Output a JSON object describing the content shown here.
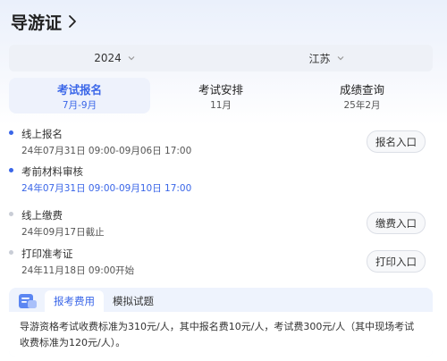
{
  "header": {
    "title": "导游证"
  },
  "filters": {
    "year": "2024",
    "province": "江苏"
  },
  "tabs": [
    {
      "label": "考试报名",
      "sub": "7月-9月",
      "active": true
    },
    {
      "label": "考试安排",
      "sub": "11月",
      "active": false
    },
    {
      "label": "成绩查询",
      "sub": "25年2月",
      "active": false
    }
  ],
  "steps": [
    {
      "title": "线上报名",
      "sub": "24年07月31日 09:00-09月06日 17:00",
      "button": "报名入口"
    },
    {
      "title": "考前材料审核",
      "sub": "24年07月31日 09:00-09月10日 17:00"
    },
    {
      "title": "线上缴费",
      "sub": "24年09月17日截止",
      "button": "缴费入口"
    },
    {
      "title": "打印准考证",
      "sub": "24年11月18日 09:00开始",
      "button": "打印入口"
    }
  ],
  "fee": {
    "tab_active": "报考费用",
    "tab_other": "模拟试题",
    "body": "导游资格考试收费标准为310元/人，其中报名费10元/人，考试费300元/人（其中现场考试收费标准为120元/人）。"
  },
  "colors": {
    "accent": "#3a66e8",
    "inactive_dot": "#c9cdd6"
  },
  "icons": {
    "title": "chevron-right-icon",
    "filter": "chevron-down-icon",
    "fee": "document-icon"
  }
}
